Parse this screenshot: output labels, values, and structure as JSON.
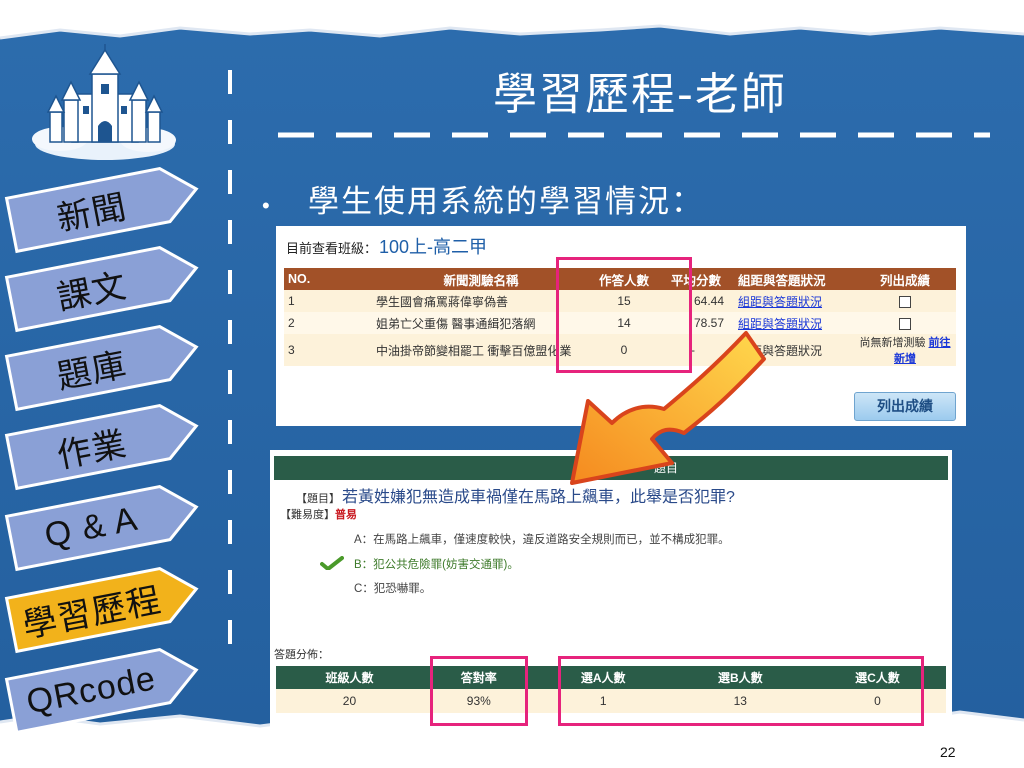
{
  "slide": {
    "title": "學習歷程-老師",
    "bullet": "學生使用系統的學習情況：",
    "page_number": "22"
  },
  "nav": {
    "items": [
      {
        "label": "新聞",
        "active": false
      },
      {
        "label": "課文",
        "active": false
      },
      {
        "label": "題庫",
        "active": false
      },
      {
        "label": "作業",
        "active": false
      },
      {
        "label": "Q & A",
        "active": false
      },
      {
        "label": "學習歷程",
        "active": true
      },
      {
        "label": "QRcode",
        "active": false
      }
    ]
  },
  "panel1": {
    "class_label": "目前查看班級：",
    "class_value": "100上-高二甲",
    "headers": [
      "NO.",
      "新聞測驗名稱",
      "作答人數",
      "平均分數",
      "組距與答題狀況",
      "列出成績"
    ],
    "rows": [
      {
        "no": "1",
        "name": "學生國會痛罵蔣偉寧偽善",
        "count": "15",
        "avg": "64.44",
        "link": "組距與答題狀況",
        "link_active": true,
        "list": "checkbox",
        "extra": ""
      },
      {
        "no": "2",
        "name": "姐弟亡父重傷 醫事通緝犯落網",
        "count": "14",
        "avg": "78.57",
        "link": "組距與答題狀況",
        "link_active": true,
        "list": "checkbox",
        "extra": ""
      },
      {
        "no": "3",
        "name": "中油掛帝節變相罷工 衝擊百億盟化業",
        "count": "0",
        "avg": "-",
        "link": "組距與答題狀況",
        "link_active": false,
        "list": "text",
        "extra": "尚無新增測驗",
        "extra_link": "前往新增"
      }
    ],
    "button": "列出成績"
  },
  "panel2": {
    "header": "題目",
    "question_bracket": "【題目】",
    "question": "若黃姓嫌犯無造成車禍僅在馬路上飆車，此舉是否犯罪?",
    "difficulty_label": "【難易度】",
    "difficulty": "普易",
    "options": [
      {
        "text": "A：在馬路上飆車，僅速度較快，違反道路安全規則而已，並不構成犯罪。",
        "correct": false
      },
      {
        "text": "B：犯公共危險罪(妨害交通罪)。",
        "correct": true
      },
      {
        "text": "C：犯恐嚇罪。",
        "correct": false
      }
    ],
    "dist_label": "答題分佈：",
    "dist_headers": [
      "班級人數",
      "答對率",
      "選A人數",
      "選B人數",
      "選C人數"
    ],
    "dist_values": [
      "20",
      "93%",
      "1",
      "13",
      "0"
    ]
  },
  "colors": {
    "slide_blue": "#2867a8",
    "nav_tab": "#8aa0d6",
    "nav_tab_active": "#f2b21b",
    "table_header_brown": "#a25128",
    "table_header_green": "#2a5c48",
    "highlight": "#e6237c",
    "arrow": "#f5a623"
  }
}
